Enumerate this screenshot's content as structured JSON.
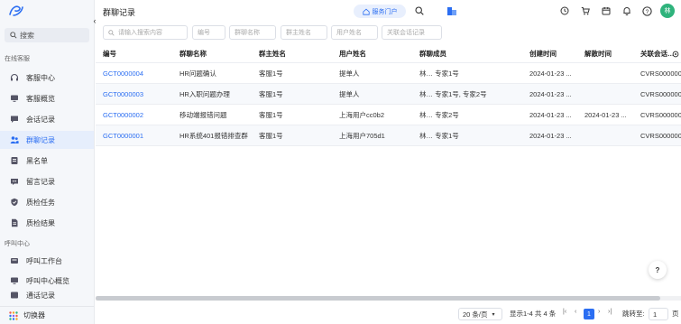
{
  "sidebar": {
    "search_label": "搜索",
    "group1_title": "在线客服",
    "items": [
      {
        "label": "客服中心",
        "icon": "headset-icon"
      },
      {
        "label": "客服概览",
        "icon": "monitor-icon"
      },
      {
        "label": "会话记录",
        "icon": "chat-icon"
      },
      {
        "label": "群聊记录",
        "icon": "group-icon"
      },
      {
        "label": "黑名单",
        "icon": "blacklist-icon"
      },
      {
        "label": "留言记录",
        "icon": "message-icon"
      },
      {
        "label": "质检任务",
        "icon": "shield-icon"
      },
      {
        "label": "质检结果",
        "icon": "document-icon"
      }
    ],
    "group2_title": "呼叫中心",
    "items2": [
      {
        "label": "呼叫工作台",
        "icon": "phone-desk-icon"
      },
      {
        "label": "呼叫中心概览",
        "icon": "monitor-icon"
      },
      {
        "label": "通话记录",
        "icon": "list-icon"
      }
    ],
    "switcher_label": "切换器"
  },
  "header": {
    "title": "群聊记录",
    "portal_label": "服务门户",
    "avatar_text": "林"
  },
  "filters": {
    "search_placeholder": "请输入搜索内容",
    "id_placeholder": "编号",
    "name_placeholder": "群聊名称",
    "owner_placeholder": "群主姓名",
    "user_placeholder": "用户姓名",
    "related_placeholder": "关联会话记录"
  },
  "table": {
    "headers": {
      "id": "编号",
      "name": "群聊名称",
      "owner": "群主姓名",
      "user": "用户姓名",
      "members": "群聊成员",
      "created": "创建时间",
      "dissolved": "解散时间",
      "related": "关联会话…"
    },
    "rows": [
      {
        "id": "GCT0000004",
        "name": "HR问题确认",
        "owner": "客服1号",
        "user": "提单人",
        "members": "林… 专家1号",
        "created": "2024-01-23 ...",
        "dissolved": "",
        "related": "CVRS000000"
      },
      {
        "id": "GCT0000003",
        "name": "HR入职问题办理",
        "owner": "客服1号",
        "user": "提单人",
        "members": "林… 专家1号, 专家2号",
        "created": "2024-01-23 ...",
        "dissolved": "",
        "related": "CVRS000000"
      },
      {
        "id": "GCT0000002",
        "name": "移动端报错问题",
        "owner": "客服1号",
        "user": "上海用户cc0b2",
        "members": "林… 专家2号",
        "created": "2024-01-23 ...",
        "dissolved": "2024-01-23 ...",
        "related": "CVRS000000"
      },
      {
        "id": "GCT0000001",
        "name": "HR系统401报错排查群",
        "owner": "客服1号",
        "user": "上海用户705d1",
        "members": "林… 专家1号",
        "created": "2024-01-23 ...",
        "dissolved": "",
        "related": "CVRS000000"
      }
    ]
  },
  "pagination": {
    "page_size": "20 条/页",
    "summary": "显示1-4 共 4 条",
    "current_page": "1",
    "goto_label": "跳转至:",
    "goto_value": "1",
    "page_suffix": "页"
  },
  "colors": {
    "accent": "#2b6ef2",
    "sidebar_bg": "#f5f7fa",
    "avatar_bg": "#2fb37c"
  }
}
